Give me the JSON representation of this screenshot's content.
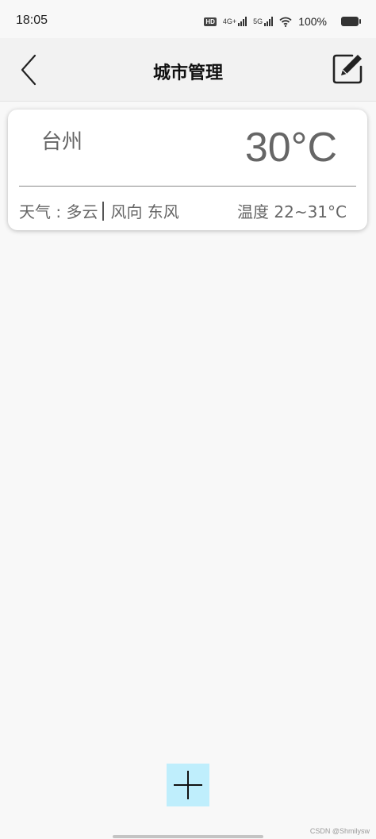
{
  "status_bar": {
    "time": "18:05",
    "hd_label": "HD",
    "network_4g": "4G+",
    "network_5g": "5G",
    "battery": "100%"
  },
  "app_bar": {
    "title": "城市管理",
    "back_icon": "chevron-left-icon",
    "edit_icon": "edit-pencil-icon"
  },
  "cities": [
    {
      "name": "台州",
      "temperature": "30°C",
      "weather": "天气 : 多云",
      "wind": "风向 东风",
      "temp_range": "温度 22~31°C"
    }
  ],
  "add_button": {
    "icon": "plus-icon",
    "color": "#bfeefc"
  },
  "watermark": "CSDN @Shmilysw"
}
